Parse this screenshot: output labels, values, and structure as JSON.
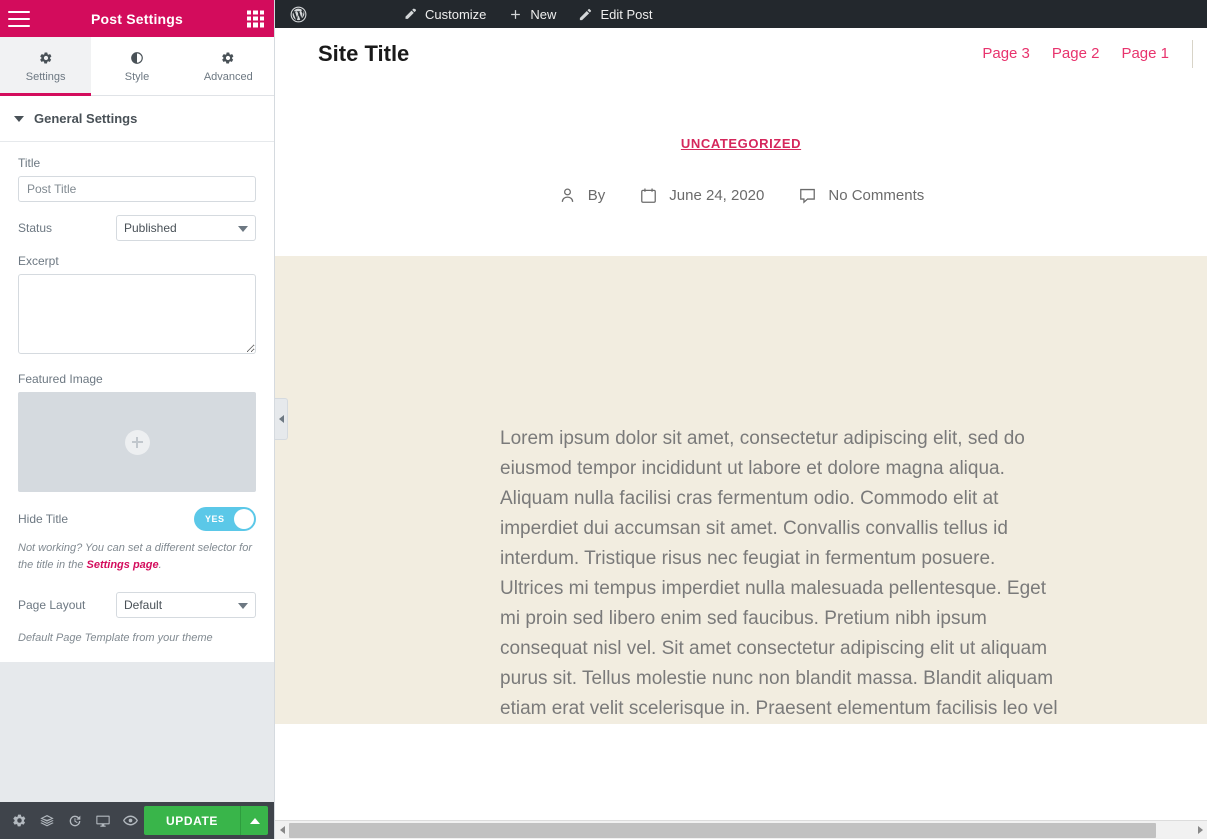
{
  "panel": {
    "header": {
      "title": "Post Settings",
      "menu_icon": "hamburger-menu-icon",
      "grid_icon": "widgets-grid-icon"
    },
    "tabs": [
      {
        "label": "Settings",
        "icon": "gear-icon",
        "active": true
      },
      {
        "label": "Style",
        "icon": "half-circle-contrast-icon",
        "active": false
      },
      {
        "label": "Advanced",
        "icon": "gear-icon",
        "active": false
      }
    ],
    "section": {
      "title": "General Settings",
      "caret": "caret-down-icon"
    },
    "fields": {
      "title_label": "Title",
      "title_value": "",
      "title_placeholder": "Post Title",
      "status_label": "Status",
      "status_value": "Published",
      "status_options": [
        "Published"
      ],
      "excerpt_label": "Excerpt",
      "excerpt_value": "",
      "featured_image_label": "Featured Image",
      "featured_image_add_icon": "plus-circle-icon",
      "hide_title_label": "Hide Title",
      "hide_title_state": "YES",
      "hide_title_help_pre": "Not working? You can set a different selector for the title in the ",
      "hide_title_help_link": "Settings page",
      "hide_title_help_post": ".",
      "page_layout_label": "Page Layout",
      "page_layout_value": "Default",
      "page_layout_options": [
        "Default"
      ],
      "page_layout_note": "Default Page Template from your theme"
    },
    "footer": {
      "icons": [
        "gear-icon",
        "layers-icon",
        "history-icon",
        "responsive-mode-icon",
        "preview-eye-icon"
      ],
      "update_label": "UPDATE",
      "update_caret_icon": "caret-up-icon"
    }
  },
  "collapse_handle": {
    "icon": "chevron-left-icon"
  },
  "preview": {
    "admin_bar": {
      "logo_icon": "wordpress-dashboard-icon",
      "items": [
        {
          "label": "Customize",
          "icon": "paintbrush-icon"
        },
        {
          "label": "New",
          "icon": "plus-icon"
        },
        {
          "label": "Edit Post",
          "icon": "pencil-icon"
        }
      ]
    },
    "site_header": {
      "site_title": "Site Title",
      "nav": [
        "Page 3",
        "Page 2",
        "Page 1"
      ]
    },
    "post": {
      "category": "UNCATEGORIZED",
      "meta": [
        {
          "label": "By",
          "icon": "person-icon"
        },
        {
          "label": "June 24, 2020",
          "icon": "calendar-icon"
        },
        {
          "label": "No Comments",
          "icon": "comment-bubble-icon"
        }
      ],
      "body": "Lorem ipsum dolor sit amet, consectetur adipiscing elit, sed do eiusmod tempor incididunt ut labore et dolore magna aliqua. Aliquam nulla facilisi cras fermentum odio. Commodo elit at imperdiet dui accumsan sit amet. Convallis convallis tellus id interdum. Tristique risus nec feugiat in fermentum posuere. Ultrices mi tempus imperdiet nulla malesuada pellentesque. Eget mi proin sed libero enim sed faucibus. Pretium nibh ipsum consequat nisl vel. Sit amet consectetur adipiscing elit ut aliquam purus sit. Tellus molestie nunc non blandit massa. Blandit aliquam etiam erat velit scelerisque in. Praesent elementum facilisis leo vel"
    }
  },
  "scrollbar": {
    "left_arrow_icon": "scroll-left-arrow-icon",
    "right_arrow_icon": "scroll-right-arrow-icon"
  },
  "colors": {
    "brand_pink": "#d30c5c",
    "accent_link": "#e8336d",
    "toggle_on": "#5bc8e8",
    "update_green": "#39b54a",
    "content_bg": "#f2ede0",
    "panel_bg": "#e6e9ec",
    "footer_bg": "#3f444b",
    "admin_bar_bg": "#23282d"
  }
}
